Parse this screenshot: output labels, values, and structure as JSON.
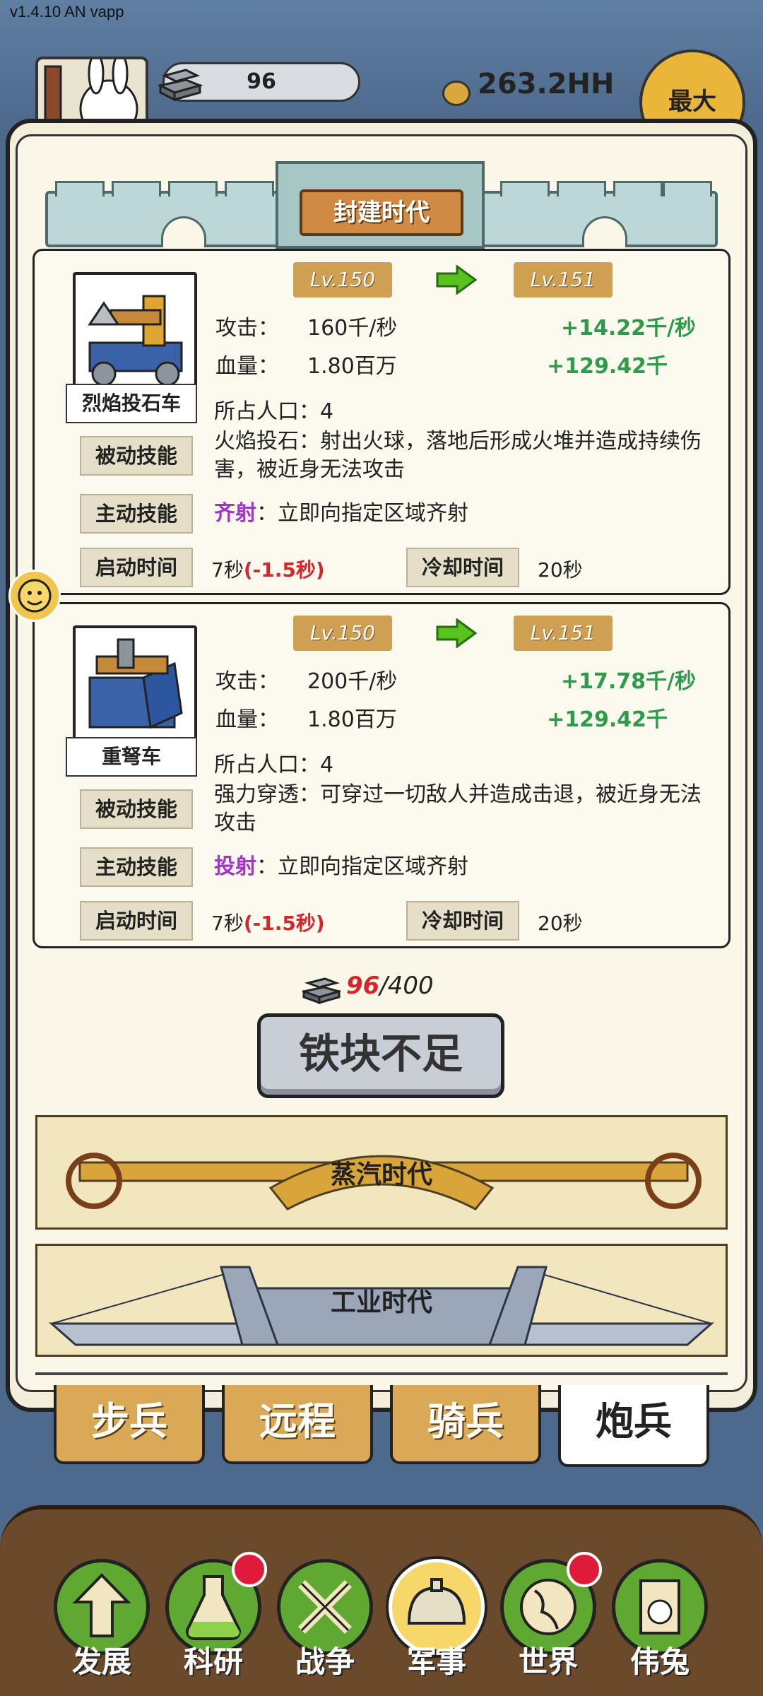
{
  "version": "v1.4.10 AN vapp",
  "topbar": {
    "iron_amount": "96",
    "coins": "263.2HH",
    "max_label": "最大"
  },
  "era": {
    "current": "封建时代",
    "next_eras": [
      "蒸汽时代",
      "工业时代"
    ]
  },
  "units": [
    {
      "name": "烈焰投石车",
      "lv_from": "Lv.150",
      "lv_to": "Lv.151",
      "attack_label": "攻击：",
      "attack_value": "160千/秒",
      "attack_delta": "+14.22千/秒",
      "hp_label": "血量：",
      "hp_value": "1.80百万",
      "hp_delta": "+129.42千",
      "population": "所占人口：4",
      "passive_label": "被动技能",
      "passive_desc": "火焰投石：射出火球，落地后形成火堆并造成持续伤害，被近身无法攻击",
      "active_label": "主动技能",
      "active_skill": "齐射",
      "active_desc": "：立即向指定区域齐射",
      "start_label": "启动时间",
      "start_value": "7秒",
      "start_reduce": "(-1.5秒)",
      "cd_label": "冷却时间",
      "cd_value": "20秒"
    },
    {
      "name": "重弩车",
      "lv_from": "Lv.150",
      "lv_to": "Lv.151",
      "attack_label": "攻击：",
      "attack_value": "200千/秒",
      "attack_delta": "+17.78千/秒",
      "hp_label": "血量：",
      "hp_value": "1.80百万",
      "hp_delta": "+129.42千",
      "population": "所占人口：4",
      "passive_label": "被动技能",
      "passive_desc": "强力穿透：可穿过一切敌人并造成击退，被近身无法攻击",
      "active_label": "主动技能",
      "active_skill": "投射",
      "active_desc": "：立即向指定区域齐射",
      "start_label": "启动时间",
      "start_value": "7秒",
      "start_reduce": "(-1.5秒)",
      "cd_label": "冷却时间",
      "cd_value": "20秒"
    }
  ],
  "cost": {
    "have": "96",
    "need": "/400"
  },
  "upgrade_button": "铁块不足",
  "tabs": [
    "步兵",
    "远程",
    "骑兵",
    "炮兵"
  ],
  "active_tab": "炮兵",
  "nav": [
    {
      "label": "发展",
      "icon": "arrow-up-icon",
      "badge": false
    },
    {
      "label": "科研",
      "icon": "flask-icon",
      "badge": true
    },
    {
      "label": "战争",
      "icon": "crossed-swords-icon",
      "badge": false
    },
    {
      "label": "军事",
      "icon": "helmet-icon",
      "badge": false,
      "active": true
    },
    {
      "label": "世界",
      "icon": "globe-icon",
      "badge": true
    },
    {
      "label": "伟兔",
      "icon": "rabbit-portrait-icon",
      "badge": false
    }
  ],
  "colors": {
    "delta_green": "#2e9a4a",
    "skill_purple": "#a333c9",
    "reduce_red": "#d6262b",
    "tab_gold": "#d9a956",
    "nav_green": "#5fa832"
  }
}
